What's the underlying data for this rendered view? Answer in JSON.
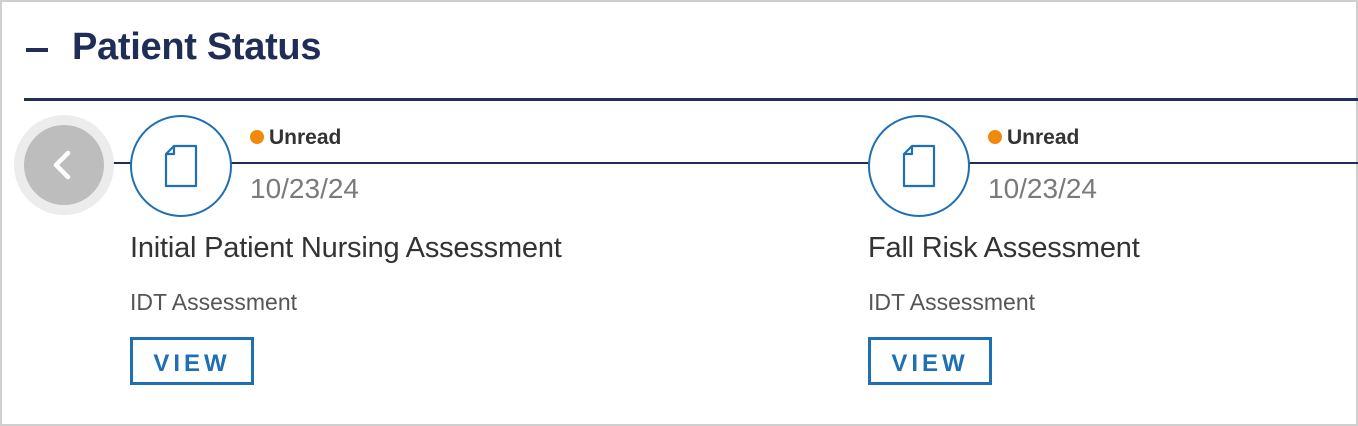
{
  "section": {
    "title": "Patient Status",
    "collapse_icon": "minus-icon",
    "prev_icon": "chevron-left-icon"
  },
  "colors": {
    "title": "#1f2d57",
    "accent": "#1f6fb5",
    "unread_dot": "#f08a0c"
  },
  "cards": [
    {
      "icon": "document-icon",
      "status": "Unread",
      "date": "10/23/24",
      "name": "Initial Patient Nursing Assessment",
      "type": "IDT Assessment",
      "view_label": "VIEW"
    },
    {
      "icon": "document-icon",
      "status": "Unread",
      "date": "10/23/24",
      "name": "Fall Risk Assessment",
      "type": "IDT Assessment",
      "view_label": "VIEW"
    }
  ]
}
